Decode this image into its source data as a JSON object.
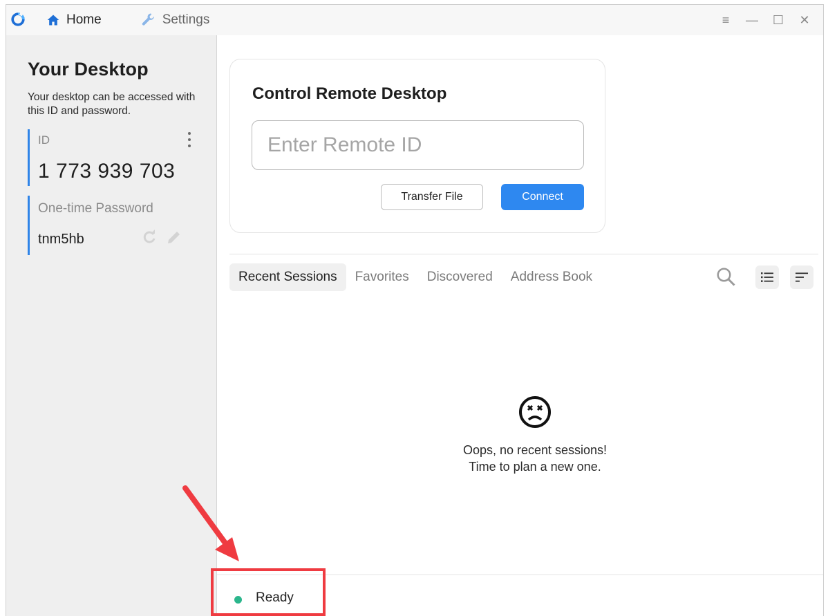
{
  "titlebar": {
    "tabs": [
      {
        "label": "Home",
        "icon": "home-icon"
      },
      {
        "label": "Settings",
        "icon": "wrench-icon"
      }
    ],
    "controls": {
      "menu": "≡",
      "minimize": "—",
      "maximize": "☐",
      "close": "✕"
    }
  },
  "sidebar": {
    "title": "Your Desktop",
    "description": "Your desktop can be accessed with this ID and password.",
    "id_label": "ID",
    "id_value": "1 773 939 703",
    "password_label": "One-time Password",
    "password_value": "tnm5hb"
  },
  "connect_card": {
    "title": "Control Remote Desktop",
    "input_placeholder": "Enter Remote ID",
    "transfer_label": "Transfer File",
    "connect_label": "Connect"
  },
  "session_tabs": [
    {
      "label": "Recent Sessions",
      "active": true
    },
    {
      "label": "Favorites",
      "active": false
    },
    {
      "label": "Discovered",
      "active": false
    },
    {
      "label": "Address Book",
      "active": false
    }
  ],
  "empty_state": {
    "line1": "Oops, no recent sessions!",
    "line2": "Time to plan a new one."
  },
  "status": {
    "text": "Ready",
    "color": "#2bb68c"
  },
  "colors": {
    "accent": "#2e88f0",
    "annotation": "#ef3b41"
  }
}
